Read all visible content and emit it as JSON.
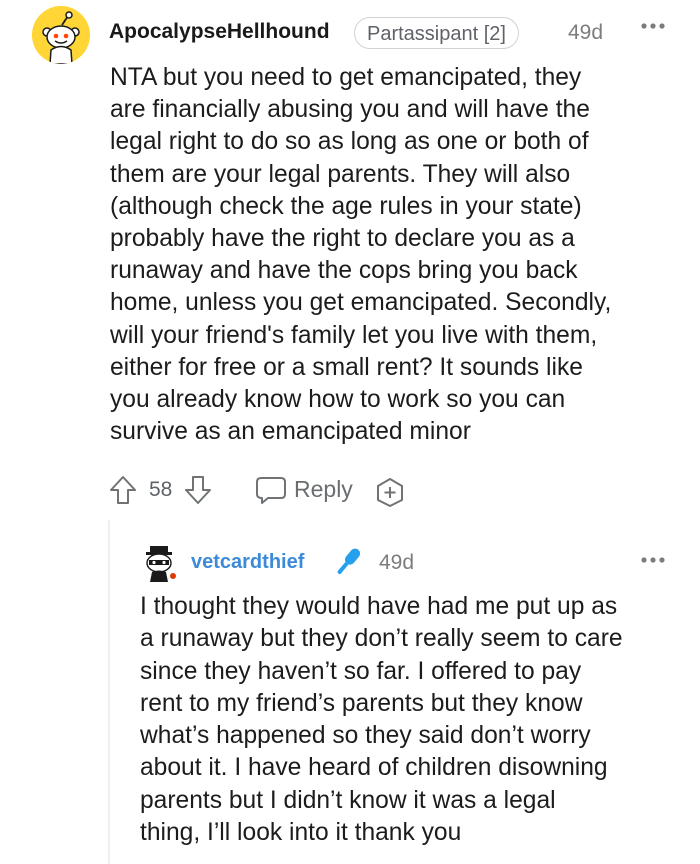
{
  "comment": {
    "username": "ApocalypseHellhound",
    "flair": "Partassipant [2]",
    "time": "49d",
    "body_lines": [
      "NTA but you need to get emancipated, they",
      "are financially abusing you and will have the",
      "legal right to do so as long as one or both of",
      "them are your legal parents. They will also",
      "(although check the age rules in your state)",
      "probably have the right to declare you as a",
      "runaway and have the cops bring you back",
      "home, unless you get emancipated. Secondly,",
      "will your friend's family let you live with them,",
      "either for free or a small rent? It sounds like",
      "you already know how to work so you can",
      "survive as an emancipated minor"
    ],
    "score": "58",
    "reply_label": "Reply",
    "avatar_icon": "snoo-avatar-icon",
    "avatar_color": "#ffd635"
  },
  "reply": {
    "username": "vetcardthief",
    "username_color": "#3d8bd8",
    "time": "49d",
    "body_lines": [
      "I thought they would have had me put up as",
      "a runaway but they don’t really seem to care",
      "since they haven’t so far. I offered to pay",
      "rent to my friend’s parents but they know",
      "what’s happened so they said don’t worry",
      "about it. I have heard of children disowning",
      "parents but I didn’t know it was a legal",
      "thing, I’ll look into it thank you"
    ],
    "avatar_icon": "snoo-avatar-icon",
    "badge_icon": "microphone-icon"
  }
}
